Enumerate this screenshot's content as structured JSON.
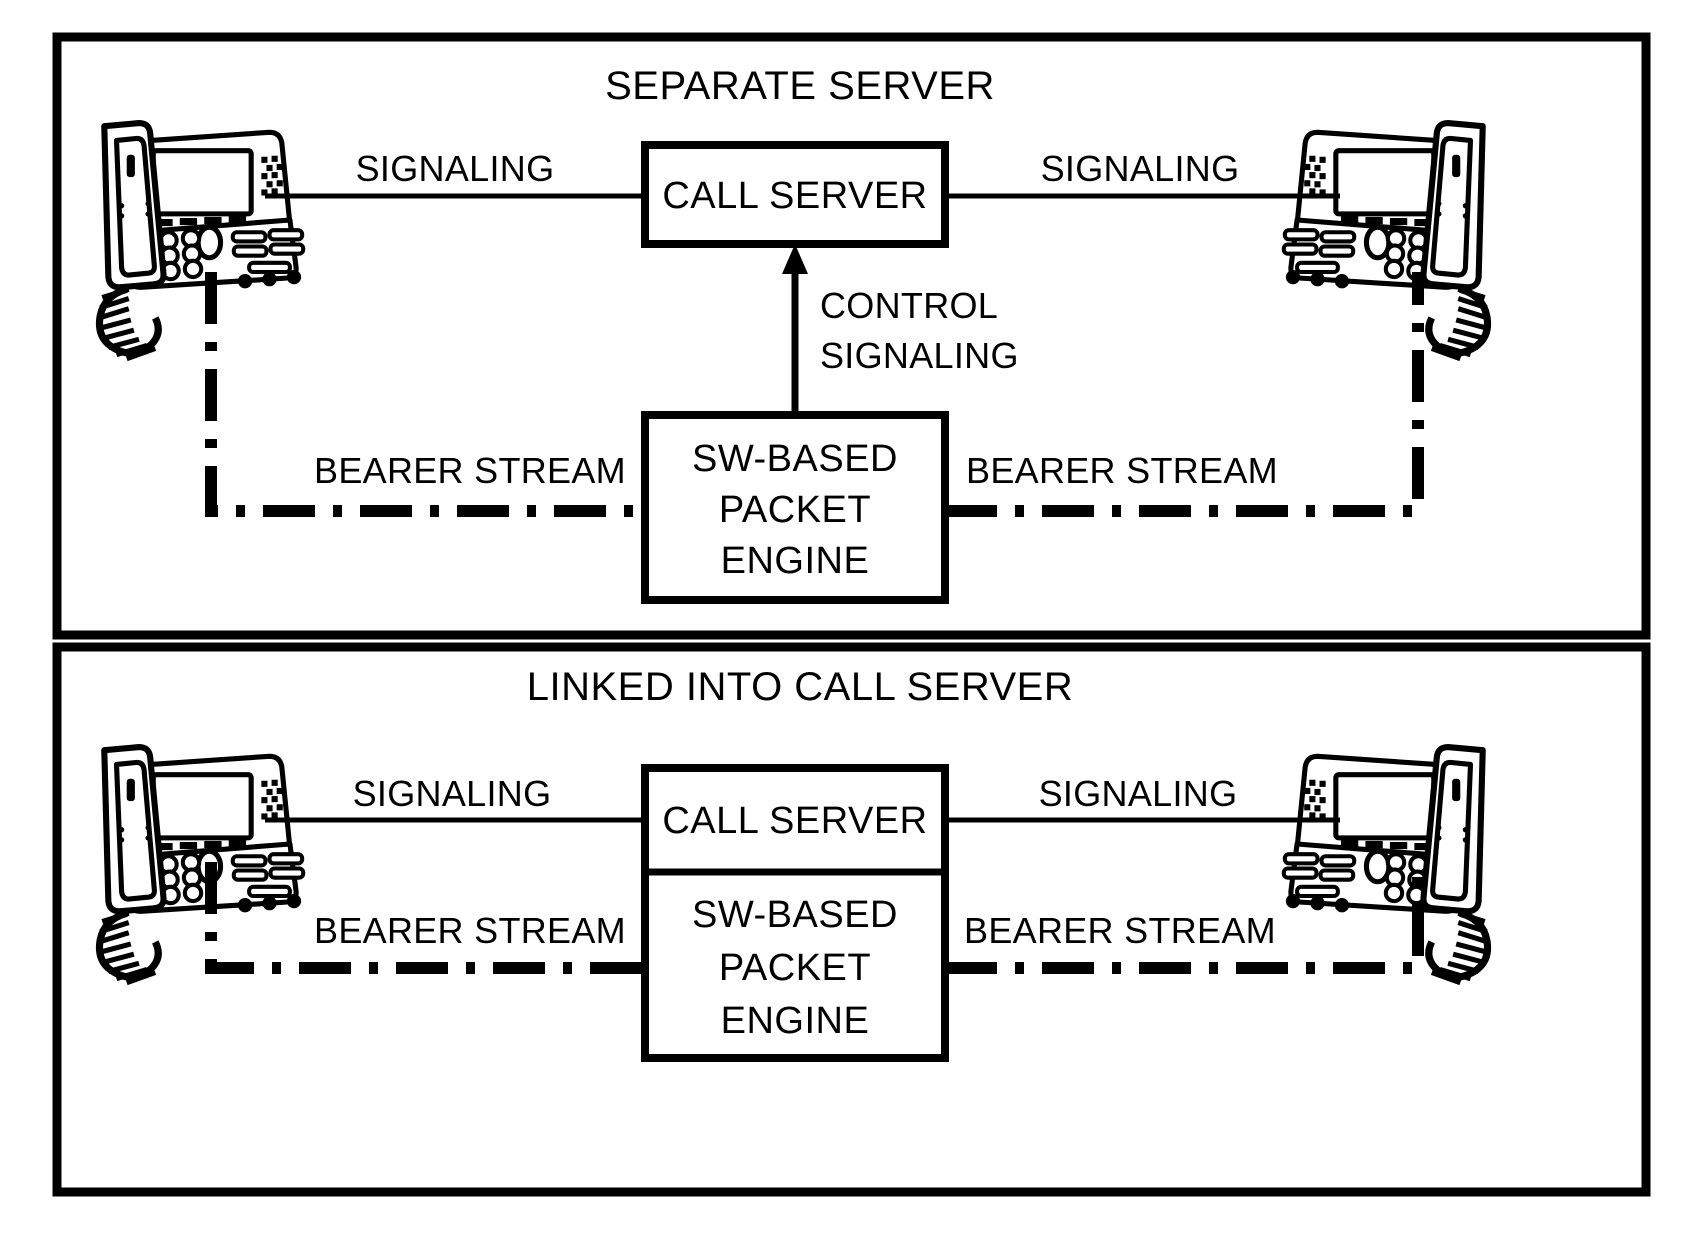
{
  "figure": {
    "title_upper": "SEPARATE SERVER",
    "title_lower": "LINKED INTO CALL SERVER"
  },
  "panels": [
    {
      "id": "separate-server",
      "title": "SEPARATE SERVER",
      "nodes": {
        "call_server": "CALL SERVER",
        "packet_engine_line1": "SW-BASED",
        "packet_engine_line2": "PACKET",
        "packet_engine_line3": "ENGINE"
      },
      "edges": {
        "signaling_left": "SIGNALING",
        "signaling_right": "SIGNALING",
        "control_line1": "CONTROL",
        "control_line2": "SIGNALING",
        "bearer_left": "BEARER STREAM",
        "bearer_right": "BEARER STREAM"
      },
      "endpoints": {
        "phone_left": "ip-phone-icon",
        "phone_right": "ip-phone-icon"
      }
    },
    {
      "id": "linked-into-call-server",
      "title": "LINKED INTO CALL SERVER",
      "nodes": {
        "call_server": "CALL SERVER",
        "packet_engine_line1": "SW-BASED",
        "packet_engine_line2": "PACKET",
        "packet_engine_line3": "ENGINE"
      },
      "edges": {
        "signaling_left": "SIGNALING",
        "signaling_right": "SIGNALING",
        "bearer_left": "BEARER STREAM",
        "bearer_right": "BEARER STREAM"
      },
      "endpoints": {
        "phone_left": "ip-phone-icon",
        "phone_right": "ip-phone-icon"
      }
    }
  ],
  "style": {
    "ink": "#000000",
    "paper": "#ffffff"
  }
}
